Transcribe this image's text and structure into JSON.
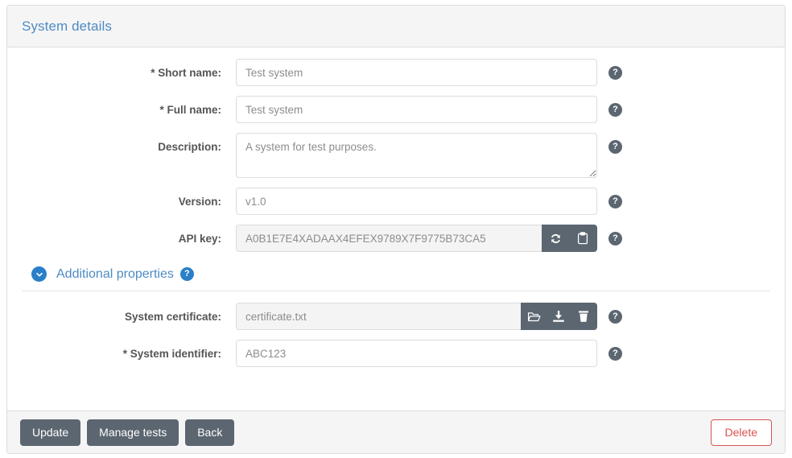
{
  "panel": {
    "title": "System details"
  },
  "form": {
    "fields": [
      {
        "label": "* Short name:",
        "value": "Test system",
        "type": "input",
        "name": "short-name"
      },
      {
        "label": "* Full name:",
        "value": "Test system",
        "type": "input",
        "name": "full-name"
      },
      {
        "label": "Description:",
        "value": "A system for test purposes.",
        "type": "textarea",
        "name": "description"
      },
      {
        "label": "Version:",
        "value": "v1.0",
        "type": "input",
        "name": "version"
      },
      {
        "label": "API key:",
        "value": "A0B1E7E4XADAAX4EFEX9789X7F9775B73CA5",
        "type": "input-group",
        "name": "api-key"
      }
    ],
    "help_label": "?"
  },
  "section": {
    "title": "Additional properties",
    "help_label": "?",
    "toggle_icon": "chevron-down-icon",
    "fields": [
      {
        "label": "System certificate:",
        "value": "certificate.txt",
        "type": "input-group",
        "name": "system-certificate"
      },
      {
        "label": "* System identifier:",
        "value": "ABC123",
        "type": "input",
        "name": "system-identifier"
      }
    ]
  },
  "api_key_actions": [
    {
      "name": "regenerate-api-key-button",
      "icon": "refresh-icon"
    },
    {
      "name": "copy-api-key-button",
      "icon": "clipboard-icon"
    }
  ],
  "certificate_actions": [
    {
      "name": "browse-certificate-button",
      "icon": "folder-open-icon"
    },
    {
      "name": "download-certificate-button",
      "icon": "download-icon"
    },
    {
      "name": "delete-certificate-button",
      "icon": "trash-icon"
    }
  ],
  "footer": {
    "update_label": "Update",
    "manage_tests_label": "Manage tests",
    "back_label": "Back",
    "delete_label": "Delete"
  },
  "colors": {
    "title_blue": "#4e8bc4",
    "accent_blue": "#2a7fc9",
    "button_gray": "#5b6670",
    "danger_red": "#d9534f",
    "header_bg": "#f5f5f5",
    "border": "#dddddd"
  }
}
